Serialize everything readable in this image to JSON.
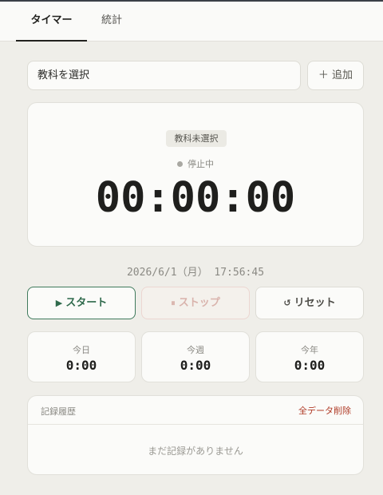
{
  "tabs": [
    {
      "label": "タイマー",
      "active": true
    },
    {
      "label": "統計",
      "active": false
    }
  ],
  "subject": {
    "select_value": "教科を選択",
    "add_label": "＋ 追加"
  },
  "timer": {
    "subject_badge": "教科未選択",
    "status": "停止中",
    "time": "00:00:00"
  },
  "datetime": "2026/6/1（月） 17:56:45",
  "controls": {
    "start_glyph": "▶",
    "start_label": "スタート",
    "stop_glyph": "⏸",
    "stop_label": "ストップ",
    "reset_glyph": "↺",
    "reset_label": "リセット"
  },
  "stats": [
    {
      "label": "今日",
      "value": "0:00"
    },
    {
      "label": "今週",
      "value": "0:00"
    },
    {
      "label": "今年",
      "value": "0:00"
    }
  ],
  "history": {
    "title": "記録履歴",
    "clear_label": "全データ削除",
    "empty_message": "まだ記録がありません"
  },
  "colors": {
    "accent_green": "#3f7a5c",
    "danger_red": "#b03c28",
    "background": "#efeee9"
  },
  "icons": {
    "start": "play-icon",
    "stop": "pause-icon",
    "reset": "reset-icon",
    "status": "status-dot-icon"
  }
}
